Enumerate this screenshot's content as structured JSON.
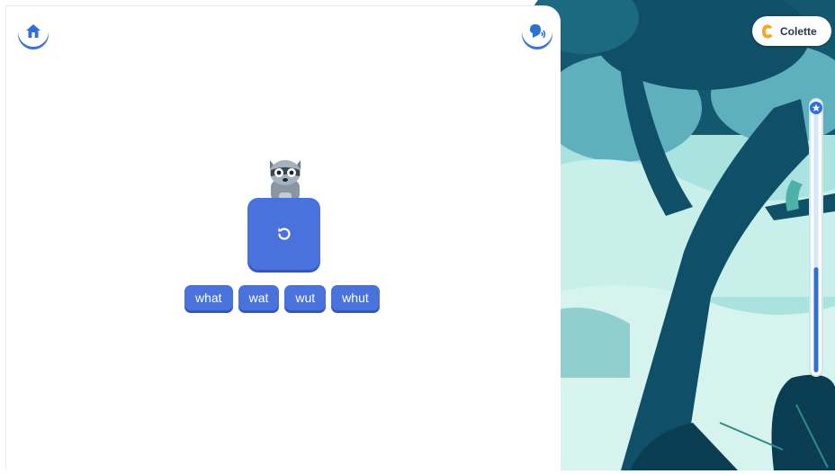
{
  "app": {
    "colors": {
      "primary": "#4a72dd",
      "primary_shadow": "#3558b8",
      "forest_dark": "#0e4a63",
      "forest_light": "#a9e2df",
      "accent_orange": "#f5a623"
    }
  },
  "toolbar": {
    "home_icon": "home-icon",
    "listen_icon": "speaker-listen-icon"
  },
  "activity": {
    "mascot_icon": "raccoon-mascot",
    "replay_icon": "replay-icon",
    "choices": [
      "what",
      "wat",
      "wut",
      "whut"
    ]
  },
  "user": {
    "name": "Colette",
    "badge_icon": "letter-c-icon"
  },
  "progress": {
    "fraction": 0.4,
    "marker_icon": "star-icon"
  }
}
